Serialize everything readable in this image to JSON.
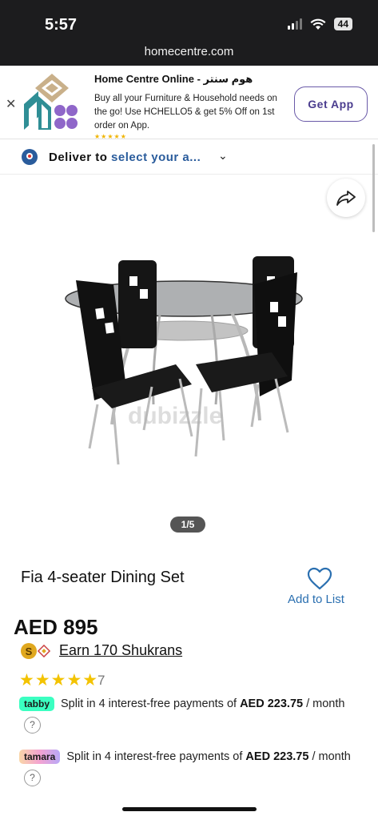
{
  "status_bar": {
    "time": "5:57",
    "battery": "44"
  },
  "browser": {
    "url": "homecentre.com"
  },
  "app_banner": {
    "title": "Home Centre Online - هوم سنتر",
    "description": "Buy all your Furniture & Household needs on the go! Use HCHELLO5 & get 5% Off on 1st order on App.",
    "stars": "★★★★★",
    "button_label": "Get App"
  },
  "delivery": {
    "prefix": "Deliver to ",
    "link": "select your a..."
  },
  "gallery": {
    "counter": "1/5",
    "watermark": "dubizzle"
  },
  "product": {
    "title": "Fia 4-seater Dining Set",
    "add_to_list": "Add to List",
    "price": "AED 895",
    "shukrans": "Earn 170 Shukrans",
    "rating_stars": "★★★★★",
    "rating_count": "7"
  },
  "payments": {
    "tabby": {
      "badge": "tabby",
      "text": "Split in 4 interest-free payments of ",
      "amount": "AED 223.75",
      "suffix": " / month"
    },
    "tamara": {
      "badge": "tamara",
      "text": "Split in 4 interest-free payments of ",
      "amount": "AED 223.75",
      "suffix": " / month"
    },
    "help_glyph": "?"
  },
  "colors": {
    "brand_purple": "#4b3d8f",
    "link_blue": "#2a6fb0",
    "star_yellow": "#f3c300",
    "tabby_green": "#3bffc1"
  }
}
